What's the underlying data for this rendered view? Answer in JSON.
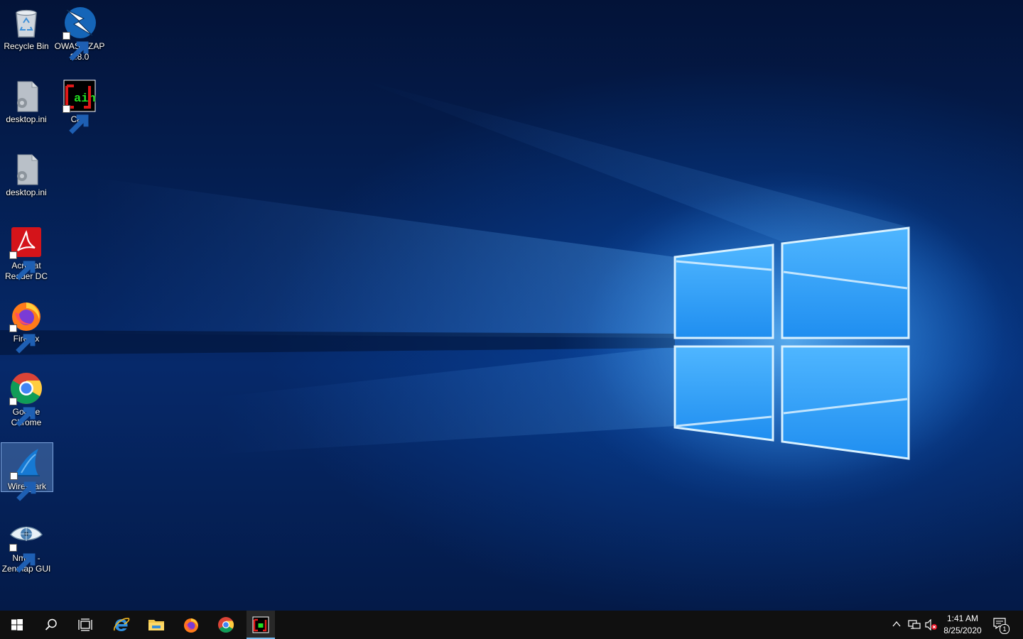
{
  "desktop": {
    "icons": [
      {
        "id": "recycle-bin",
        "label": "Recycle Bin",
        "icon": "recycle-bin-icon",
        "shortcut": false
      },
      {
        "id": "owasp-zap",
        "label": "OWASP ZAP 2.8.0",
        "icon": "owasp-zap-icon",
        "shortcut": true
      },
      {
        "id": "desktop-ini-1",
        "label": "desktop.ini",
        "icon": "settings-file-icon",
        "shortcut": false
      },
      {
        "id": "cain",
        "label": "Cain",
        "icon": "cain-icon",
        "shortcut": true
      },
      {
        "id": "desktop-ini-2",
        "label": "desktop.ini",
        "icon": "settings-file-icon",
        "shortcut": false
      },
      {
        "id": "acrobat",
        "label": "Acrobat Reader DC",
        "icon": "acrobat-icon",
        "shortcut": true
      },
      {
        "id": "firefox",
        "label": "Firefox",
        "icon": "firefox-icon",
        "shortcut": true
      },
      {
        "id": "chrome",
        "label": "Google Chrome",
        "icon": "chrome-icon",
        "shortcut": true
      },
      {
        "id": "wireshark",
        "label": "Wireshark",
        "icon": "wireshark-icon",
        "shortcut": true,
        "selected": true
      },
      {
        "id": "nmap",
        "label": "Nmap - Zenmap GUI",
        "icon": "zenmap-icon",
        "shortcut": true
      }
    ],
    "cain_icon_text": "ain"
  },
  "taskbar": {
    "buttons": [
      {
        "name": "start-button",
        "icon": "windows-logo-icon"
      },
      {
        "name": "search-button",
        "icon": "search-icon"
      },
      {
        "name": "task-view-button",
        "icon": "task-view-icon"
      },
      {
        "name": "edge-taskbar-button",
        "icon": "internet-explorer-icon"
      },
      {
        "name": "file-explorer-taskbar-button",
        "icon": "folder-icon"
      },
      {
        "name": "firefox-taskbar-button",
        "icon": "firefox-icon"
      },
      {
        "name": "chrome-taskbar-button",
        "icon": "chrome-icon"
      },
      {
        "name": "cain-taskbar-button",
        "icon": "cain-icon",
        "active": true
      }
    ],
    "tray": {
      "icons": [
        "chevron-up-icon",
        "network-icon",
        "volume-muted-icon"
      ],
      "time": "1:41 AM",
      "date": "8/25/2020",
      "notification_count": "1"
    },
    "accent": "#76b9ed"
  }
}
